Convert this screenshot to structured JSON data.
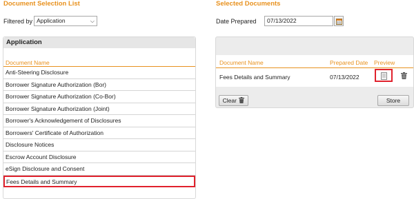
{
  "left": {
    "title": "Document Selection List",
    "filter_label": "Filtered by",
    "filter_value": "Application",
    "panel_header": "Application",
    "column_header": "Document Name",
    "documents": [
      {
        "label": "Anti-Steering Disclosure"
      },
      {
        "label": "Borrower Signature Authorization (Bor)"
      },
      {
        "label": "Borrower Signature Authorization (Co-Bor)"
      },
      {
        "label": "Borrower Signature Authorization (Joint)"
      },
      {
        "label": "Borrower's Acknowledgement of Disclosures"
      },
      {
        "label": "Borrowers' Certificate of Authorization"
      },
      {
        "label": "Disclosure Notices"
      },
      {
        "label": "Escrow Account Disclosure"
      },
      {
        "label": "eSign Disclosure and Consent"
      },
      {
        "label": "Fees Details and Summary"
      }
    ],
    "selected_document": "Fees Details and Summary"
  },
  "right": {
    "title": "Selected Documents",
    "date_label": "Date Prepared",
    "date_value": "07/13/2022",
    "columns": {
      "name": "Document Name",
      "prepared": "Prepared Date",
      "preview": "Preview"
    },
    "rows": [
      {
        "name": "Fees Details and Summary",
        "prepared": "07/13/2022"
      }
    ],
    "clear_label": "Clear",
    "store_label": "Store"
  },
  "colors": {
    "accent": "#e8911e",
    "highlight": "#e0212c"
  },
  "icons": [
    "chevron-down-icon",
    "calendar-icon",
    "document-preview-icon",
    "trash-icon"
  ]
}
